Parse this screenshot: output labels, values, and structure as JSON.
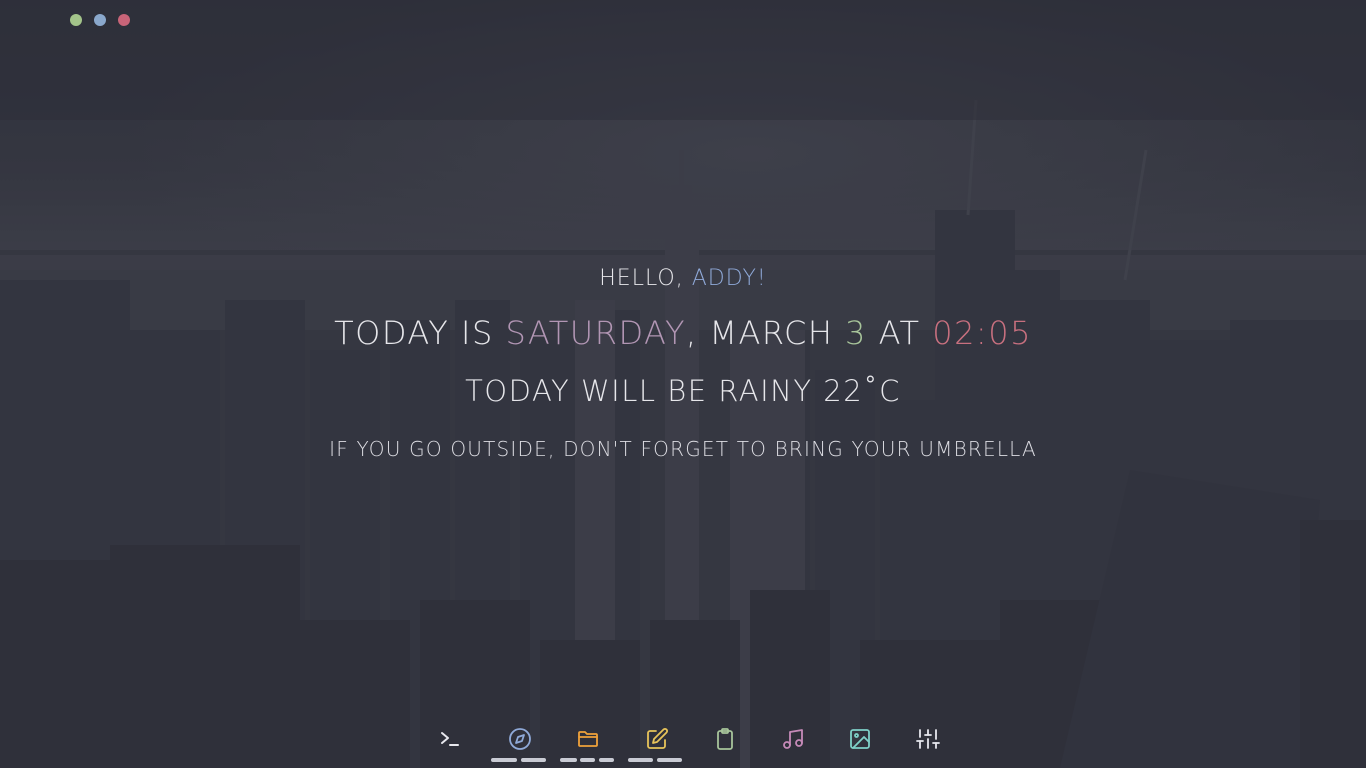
{
  "window_controls": [
    {
      "name": "minimize",
      "color": "#a3c48a"
    },
    {
      "name": "maximize",
      "color": "#8aa8cc"
    },
    {
      "name": "close",
      "color": "#c86478"
    }
  ],
  "greeting": {
    "prefix": "HELLO, ",
    "name": "ADDY!",
    "name_color": "#8fa9d8"
  },
  "date_line": {
    "prefix": "TODAY IS ",
    "weekday": "SATURDAY",
    "weekday_color": "#b296b4",
    "sep1": ", MARCH ",
    "day": "3",
    "day_color": "#a7c49a",
    "at": " AT ",
    "time": "02:05",
    "time_color": "#c8707f"
  },
  "weather_line": {
    "text": "TODAY WILL BE RAINY 22˚C"
  },
  "advice_line": {
    "text": "IF YOU GO OUTSIDE, DON'T FORGET TO BRING YOUR UMBRELLA"
  },
  "dock": {
    "items": [
      {
        "icon": "terminal-icon",
        "color": "#e8e8ee"
      },
      {
        "icon": "compass-icon",
        "color": "#8fa9d8"
      },
      {
        "icon": "folder-icon",
        "color": "#f0a23a"
      },
      {
        "icon": "edit-icon",
        "color": "#e8c45a"
      },
      {
        "icon": "clipboard-icon",
        "color": "#a7c49a"
      },
      {
        "icon": "music-icon",
        "color": "#c68ab8"
      },
      {
        "icon": "image-icon",
        "color": "#7fd0c8"
      },
      {
        "icon": "sliders-icon",
        "color": "#e8e8ee"
      }
    ]
  }
}
